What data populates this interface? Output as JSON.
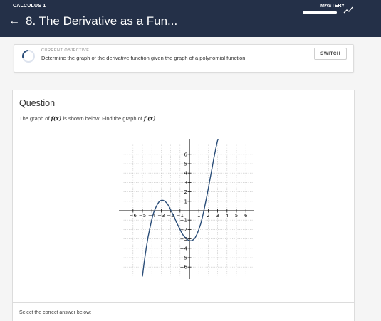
{
  "header": {
    "course": "CALCULUS 1",
    "mastery_label": "MASTERY",
    "mastery_progress": 1.0,
    "back_icon": "arrow-left-icon",
    "trend_icon": "trending-up-icon",
    "title": "8. The Derivative as a Fun..."
  },
  "objective": {
    "caption": "CURRENT OBJECTIVE",
    "text": "Determine the graph of the derivative function given the graph of a polynomial function",
    "switch_label": "SWITCH",
    "status_icon": "progress-ring-icon"
  },
  "question": {
    "heading": "Question",
    "prompt_before": "The graph of ",
    "prompt_f": "f(x)",
    "prompt_middle": " is shown below. Find the graph of ",
    "prompt_fprime": "f′(x)",
    "prompt_after": ".",
    "select_text": "Select the correct answer below:"
  },
  "colors": {
    "header_bg": "#243048",
    "curve": "#2a4d78",
    "page_bg": "#f5f5f5"
  },
  "chart_data": {
    "type": "line",
    "title": "",
    "xlabel": "",
    "ylabel": "",
    "xlim": [
      -6.5,
      6.5
    ],
    "ylim": [
      -7,
      7
    ],
    "grid": true,
    "x_ticks": [
      -6,
      -5,
      -4,
      -3,
      -2,
      -1,
      1,
      2,
      3,
      4,
      5,
      6
    ],
    "y_ticks": [
      -6,
      -5,
      -4,
      -3,
      -2,
      -1,
      1,
      2,
      3,
      4,
      5,
      6
    ],
    "x_tick_labels": [
      "−6",
      "−5",
      "−4",
      "−3",
      "−2",
      "−1",
      "1",
      "2",
      "3",
      "4",
      "5",
      "6"
    ],
    "y_tick_labels": [
      "−6",
      "−5",
      "−4",
      "−3",
      "−2",
      "−1",
      "1",
      "2",
      "3",
      "4",
      "5",
      "6"
    ],
    "series": [
      {
        "x": [
          -5.0,
          -4.8,
          -4.6,
          -4.4,
          -4.2,
          -4.0,
          -3.8,
          -3.6,
          -3.4,
          -3.2,
          -3.0,
          -2.8,
          -2.6,
          -2.4,
          -2.2,
          -2.0,
          -1.8,
          -1.6,
          -1.4,
          -1.2,
          -1.0,
          -0.8,
          -0.6,
          -0.4,
          -0.2,
          0.0,
          0.2,
          0.4,
          0.6,
          0.8,
          1.0,
          1.2,
          1.4,
          1.6,
          1.8,
          2.0,
          2.2,
          2.4,
          2.6,
          2.8,
          3.0,
          3.2,
          3.4
        ],
        "y": [
          -7.0,
          -5.4,
          -4.0,
          -2.8,
          -1.8,
          -0.9,
          -0.2,
          0.3,
          0.7,
          1.0,
          1.1,
          1.1,
          1.0,
          0.8,
          0.5,
          0.1,
          -0.3,
          -0.7,
          -1.2,
          -1.6,
          -2.0,
          -2.4,
          -2.7,
          -2.9,
          -3.1,
          -3.2,
          -3.2,
          -3.1,
          -2.9,
          -2.5,
          -2.0,
          -1.4,
          -0.6,
          0.3,
          1.3,
          2.3,
          3.4,
          4.5,
          5.6,
          6.6,
          7.5,
          8.3,
          9.0
        ]
      }
    ]
  }
}
